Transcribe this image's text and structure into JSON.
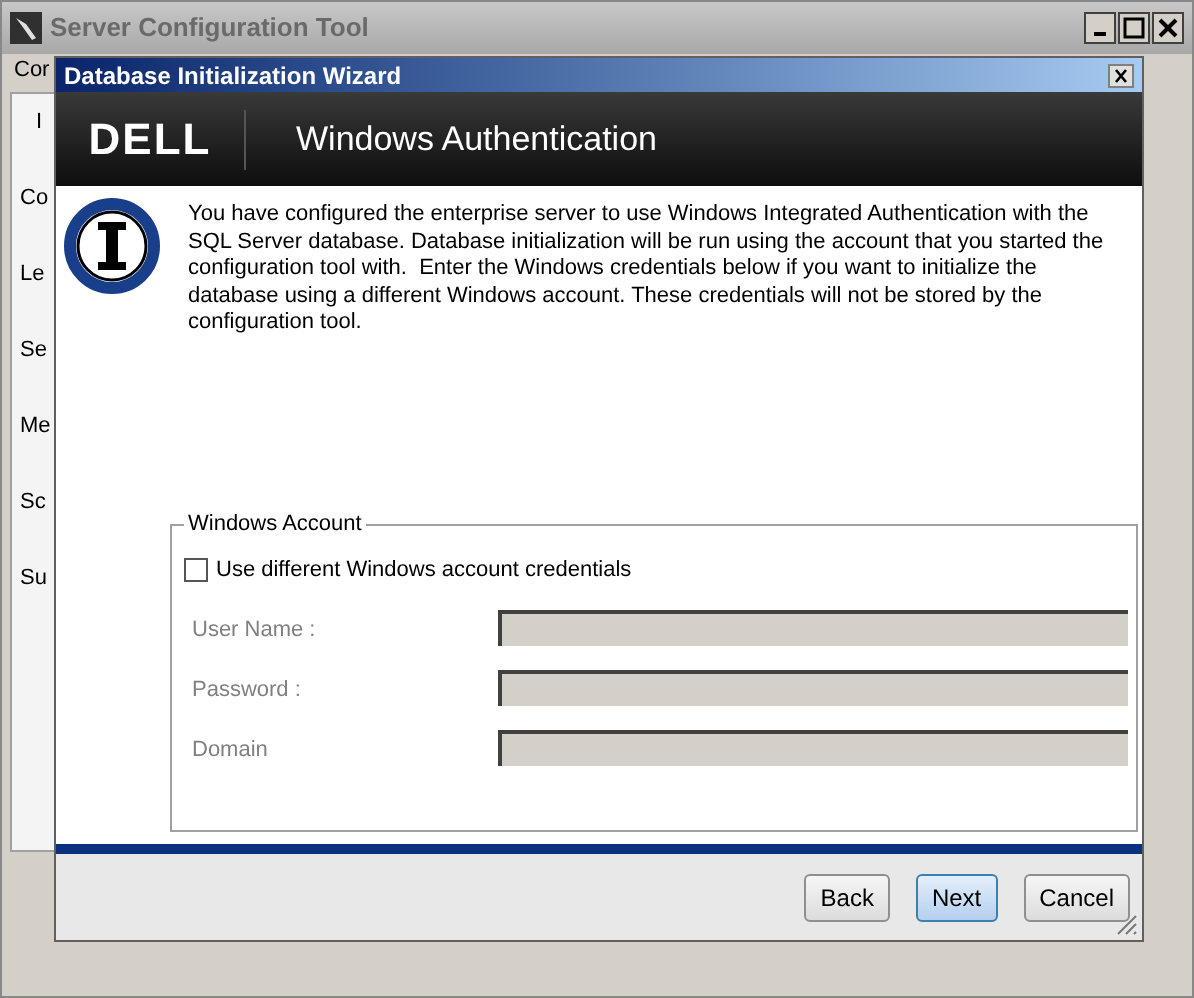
{
  "main_window": {
    "title": "Server Configuration Tool",
    "menu_fragment": "Cor",
    "side_fragments": [
      "I",
      "Co",
      "Le",
      "Se",
      "Me",
      "Sc",
      "Su"
    ]
  },
  "dialog": {
    "title": "Database Initialization Wizard",
    "banner": {
      "logo": "DELL",
      "heading": "Windows Authentication"
    },
    "message": "You have configured the enterprise server to use Windows Integrated Authentication with the SQL Server database. Database initialization will be run using the account that you started the configuration tool with.  Enter the Windows credentials below if you want to initialize the database using a different Windows account. These credentials will not be stored by the configuration tool.",
    "group": {
      "legend": "Windows Account",
      "checkbox": {
        "label": "Use different Windows account credentials",
        "checked": false
      },
      "fields": [
        {
          "label": "User Name :",
          "disabled": true
        },
        {
          "label": "Password :",
          "disabled": true
        },
        {
          "label": "Domain",
          "disabled": true
        }
      ]
    },
    "buttons": [
      {
        "label": "Back",
        "default": false
      },
      {
        "label": "Next",
        "default": true
      },
      {
        "label": "Cancel",
        "default": false
      }
    ]
  }
}
